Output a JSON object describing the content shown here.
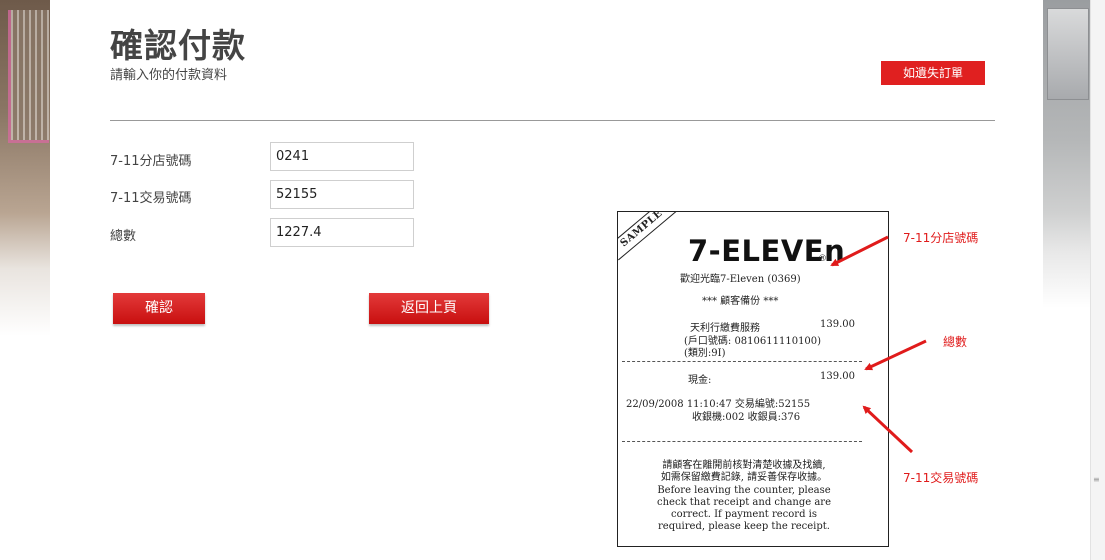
{
  "page": {
    "title": "確認付款",
    "subtitle": "請輸入你的付款資料",
    "lost_order_label": "如遺失訂單"
  },
  "form": {
    "store_label": "7-11分店號碼",
    "store_value": "0241",
    "txn_label": "7-11交易號碼",
    "txn_value": "52155",
    "total_label": "總數",
    "total_value": "1227.4",
    "confirm_label": "確認",
    "back_label": "返回上頁"
  },
  "receipt": {
    "sample_stamp": "SAMPLE",
    "logo": "7-ELEVEn",
    "logo_mark": "®",
    "welcome": "歡迎光臨7-Eleven (0369)",
    "customer_copy": "*** 顧客備份 ***",
    "merchant": "天利行繳費服務",
    "merchant_amount": "139.00",
    "account_line": "(戶口號碼: 0810611110100)",
    "type_line": "(類別:9I)",
    "cash_label": "現金:",
    "cash_amount": "139.00",
    "datetime_txn": "22/09/2008 11:10:47  交易編號:52155",
    "register_line": "收銀機:002  收銀員:376",
    "note_zh_1": "請顧客在離開前核對清楚收據及找續,",
    "note_zh_2": "如需保留繳費記錄, 請妥善保存收據。",
    "note_en_1": "Before leaving the counter, please",
    "note_en_2": "check that receipt and change are",
    "note_en_3": "correct.  If payment record is",
    "note_en_4": "required, please keep the receipt."
  },
  "annotations": {
    "store": "7-11分店號碼",
    "total": "總數",
    "txn": "7-11交易號碼"
  },
  "colors": {
    "accent_red": "#e02020",
    "annotation_red": "#e01b1b"
  }
}
